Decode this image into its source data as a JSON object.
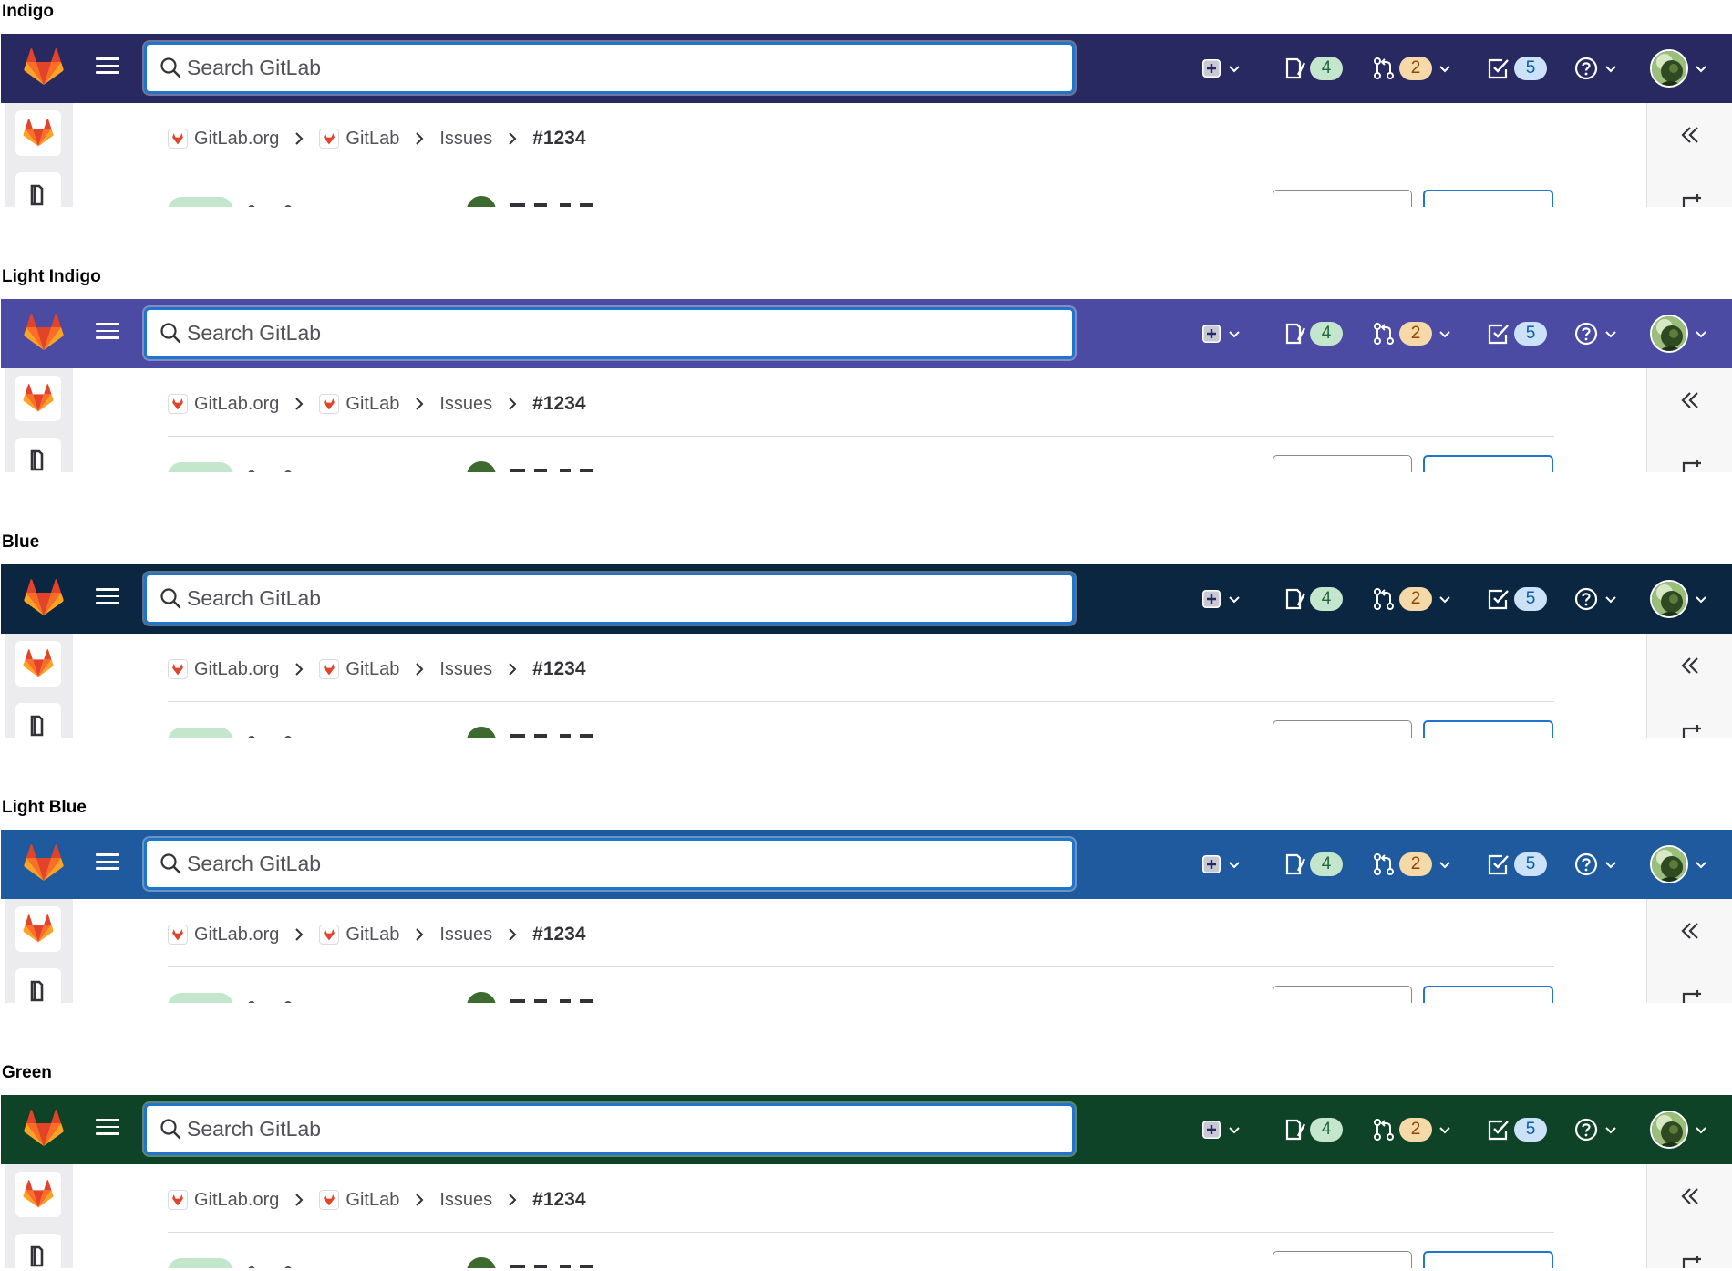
{
  "themes": [
    {
      "name": "Indigo",
      "navbar_color": "#292961"
    },
    {
      "name": "Light Indigo",
      "navbar_color": "#4b4ba3"
    },
    {
      "name": "Blue",
      "navbar_color": "#0b2640"
    },
    {
      "name": "Light Blue",
      "navbar_color": "#1f5a9e"
    },
    {
      "name": "Green",
      "navbar_color": "#0e4328"
    }
  ],
  "search": {
    "placeholder": "Search GitLab"
  },
  "nav": {
    "create_icon": "plus-square-icon",
    "issues_count": "4",
    "merge_requests_count": "2",
    "todos_count": "5",
    "help_icon": "question-icon"
  },
  "breadcrumb": {
    "items": [
      "GitLab.org",
      "GitLab",
      "Issues"
    ],
    "current": "#1234"
  },
  "colors": {
    "accent": "#1f75cb",
    "issues_badge": "#c3e6cd",
    "mr_badge": "#f5d9a8",
    "todo_badge": "#cbe2f9"
  }
}
